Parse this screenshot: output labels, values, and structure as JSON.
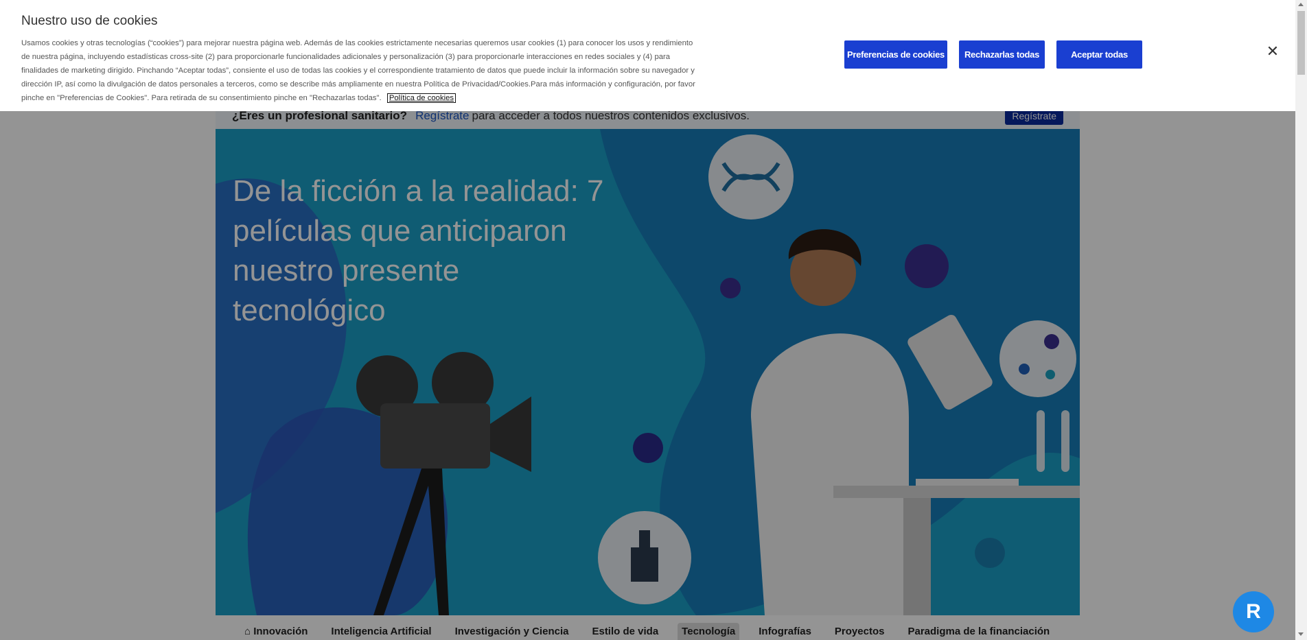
{
  "cookie": {
    "title": "Nuestro uso de cookies",
    "text": "Usamos cookies y otras tecnologías (“cookies”) para mejorar nuestra página web. Además de las cookies estrictamente necesarias queremos usar cookies (1) para conocer los usos y rendimiento de nuestra página, incluyendo estadísticas cross-site (2) para proporcionarle funcionalidades adicionales y personalización (3) para proporcionarle interacciones en redes sociales y (4) para finalidades de marketing dirigido. Pinchando “Aceptar todas”, consiente el uso de todas las cookies y el correspondiente tratamiento de datos que puede incluir la información sobre su navegador y dirección IP, así como la divulgación de datos personales a terceros, como se describe más ampliamente en nuestra Política de Privacidad/Cookies.Para más información y configuración, por favor pinche en \"Preferencias de Cookies\". Para retirada de su consentimiento pinche en \"Rechazarlas todas\".",
    "link": "Política de cookies",
    "buttons": {
      "prefs": "Preferencias de cookies",
      "reject": "Rechazarlas todas",
      "accept": "Aceptar todas"
    },
    "close_icon": "close-icon"
  },
  "pro_bar": {
    "question": "¿Eres un profesional sanitario?",
    "link": "Regístrate",
    "rest": "para acceder a todos nuestros contenidos exclusivos.",
    "button": "Regístrate"
  },
  "hero": {
    "title": "De la ficción a la realidad: 7 películas que anticiparon nuestro presente tecnológico"
  },
  "nav": {
    "items": [
      {
        "label": "⌂ Innovación"
      },
      {
        "label": "Inteligencia Artificial"
      },
      {
        "label": "Investigación y Ciencia"
      },
      {
        "label": "Estilo de vida"
      },
      {
        "label": "Tecnología"
      },
      {
        "label": "Infografías"
      },
      {
        "label": "Proyectos"
      },
      {
        "label": "Paradigma de la financiación"
      }
    ]
  },
  "colors": {
    "accent": "#1a3fd1",
    "hero_bg": "#1a9fc6"
  }
}
